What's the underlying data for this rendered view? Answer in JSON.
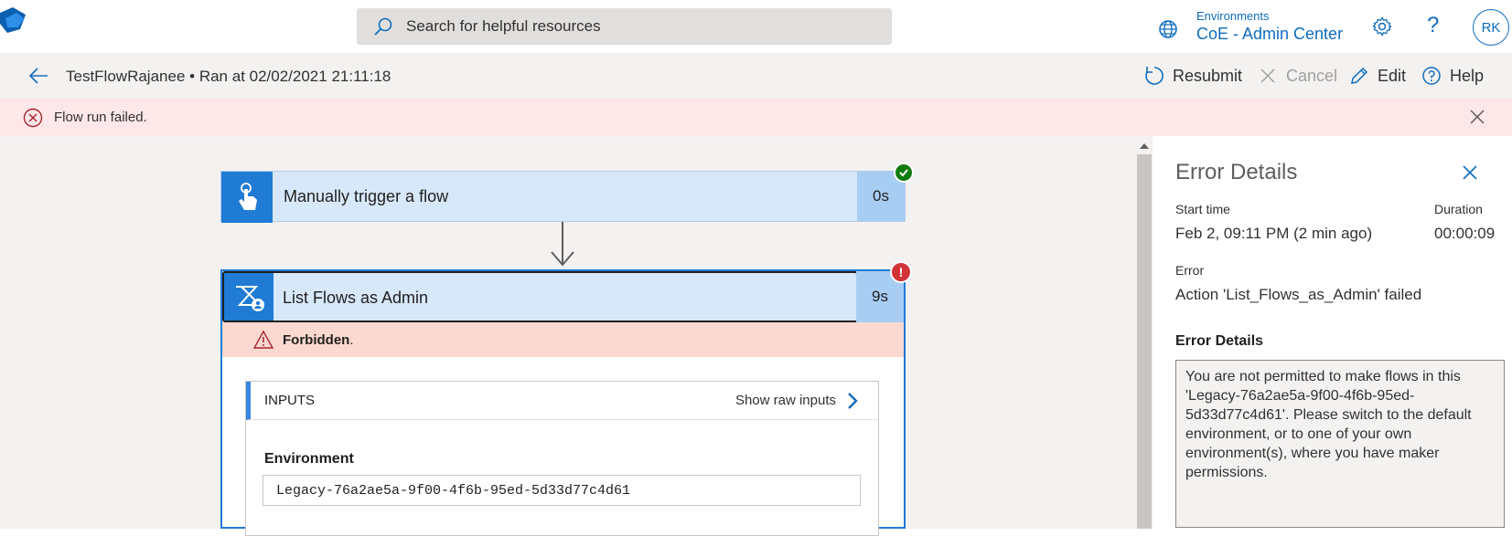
{
  "header": {
    "search_placeholder": "Search for helpful resources",
    "environment_label": "Environments",
    "environment_value": "CoE - Admin Center",
    "help_glyph": "?",
    "user_initials": "RK"
  },
  "command_bar": {
    "flow_name": "TestFlowRajanee",
    "separator": "•",
    "run_info": "Ran at 02/02/2021 21:11:18",
    "resubmit": "Resubmit",
    "cancel": "Cancel",
    "edit": "Edit",
    "help": "Help"
  },
  "banner": {
    "message": "Flow run failed."
  },
  "flow": {
    "steps": [
      {
        "title": "Manually trigger a flow",
        "duration": "0s",
        "status": "succeeded"
      },
      {
        "title": "List Flows as Admin",
        "duration": "9s",
        "status": "failed",
        "error_title": "Forbidden",
        "error_suffix": ".",
        "inputs_label": "INPUTS",
        "raw_inputs_link": "Show raw inputs",
        "environment_label": "Environment",
        "environment_value": "Legacy-76a2ae5a-9f00-4f6b-95ed-5d33d77c4d61"
      }
    ],
    "error_badge": "!"
  },
  "error_panel": {
    "title": "Error Details",
    "start_time_label": "Start time",
    "start_time_value": "Feb 2, 09:11 PM (2 min ago)",
    "duration_label": "Duration",
    "duration_value": "00:00:09",
    "error_label": "Error",
    "error_value": "Action 'List_Flows_as_Admin' failed",
    "details_label": "Error Details",
    "details_text": "You are not permitted to make flows in this 'Legacy-76a2ae5a-9f00-4f6b-95ed-5d33d77c4d61'. Please switch to the default environment, or to one of your own environment(s), where you have maker permissions."
  },
  "colors": {
    "accent": "#0f6cbd",
    "error_banner": "#fde7e9",
    "step_header": "#d7e8fb",
    "success": "#107c10",
    "failure": "#d13438"
  }
}
